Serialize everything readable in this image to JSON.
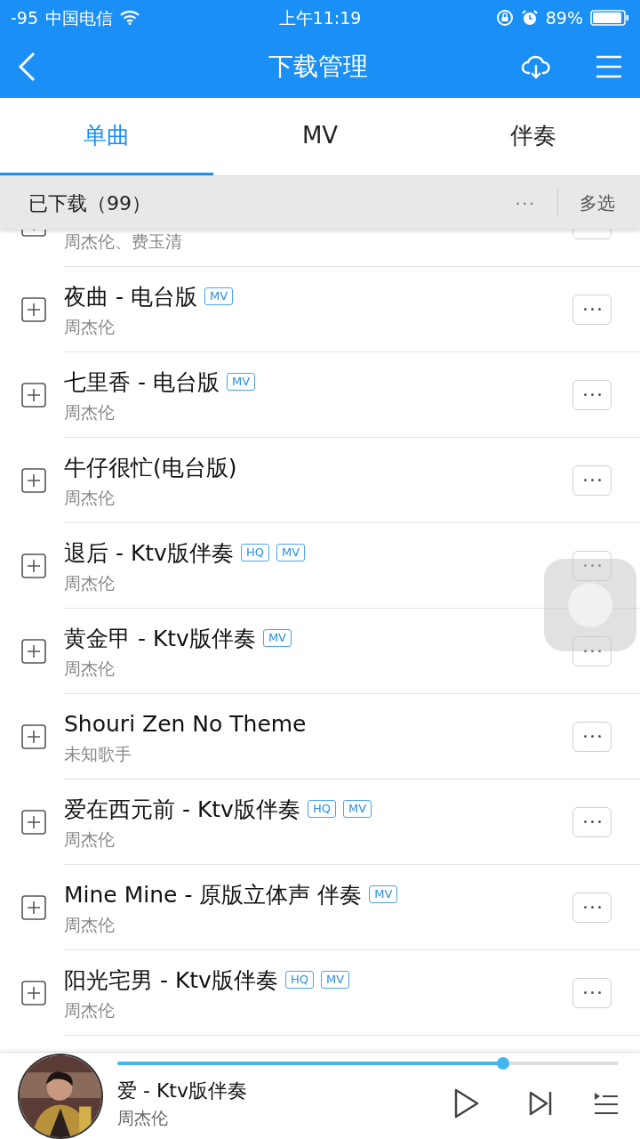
{
  "status_bar": {
    "signal": "-95",
    "carrier": "中国电信",
    "time": "上午11:19",
    "battery": "89%"
  },
  "nav": {
    "title": "下载管理"
  },
  "tabs": [
    {
      "label": "单曲",
      "selected": true
    },
    {
      "label": "MV",
      "selected": false
    },
    {
      "label": "伴奏",
      "selected": false
    }
  ],
  "list_header": {
    "title": "已下载（99）",
    "more": "···",
    "multi_select": "多选"
  },
  "songs": [
    {
      "artist": "周杰伦、费玉清"
    },
    {
      "title": "夜曲 - 电台版",
      "artist": "周杰伦",
      "tags": [
        "MV"
      ]
    },
    {
      "title": "七里香 - 电台版",
      "artist": "周杰伦",
      "tags": [
        "MV"
      ]
    },
    {
      "title": "牛仔很忙(电台版)",
      "artist": "周杰伦"
    },
    {
      "title": "退后 - Ktv版伴奏",
      "artist": "周杰伦",
      "tags": [
        "HQ",
        "MV"
      ]
    },
    {
      "title": "黄金甲 - Ktv版伴奏",
      "artist": "周杰伦",
      "tags": [
        "MV"
      ]
    },
    {
      "title": "Shouri Zen No Theme",
      "artist": "未知歌手"
    },
    {
      "title": "爱在西元前 - Ktv版伴奏",
      "artist": "周杰伦",
      "tags": [
        "HQ",
        "MV"
      ]
    },
    {
      "title": "Mine Mine - 原版立体声 伴奏",
      "artist": "周杰伦",
      "tags": [
        "MV"
      ]
    },
    {
      "title": "阳光宅男 - Ktv版伴奏",
      "artist": "周杰伦",
      "tags": [
        "HQ",
        "MV"
      ]
    }
  ],
  "player": {
    "title": "爱 - Ktv版伴奏",
    "artist": "周杰伦",
    "level": 0.77
  }
}
